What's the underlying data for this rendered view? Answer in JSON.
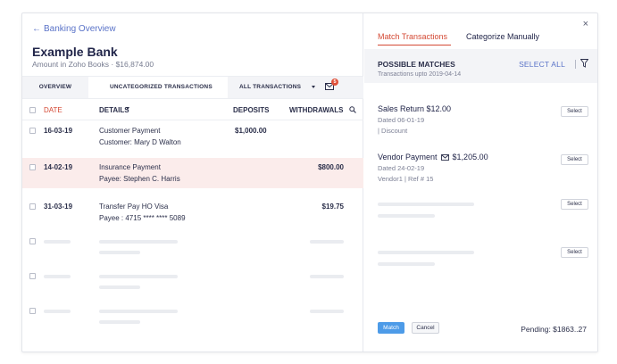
{
  "left": {
    "back_link": "Banking Overview",
    "bank_name": "Example Bank",
    "amount_label": "Amount in Zoho Books",
    "amount_value": "$16,874.00",
    "tabs": {
      "overview": "OVERVIEW",
      "uncategorized": "UNCATEGORIZED TRANSACTIONS",
      "all": "ALL TRANSACTIONS"
    },
    "mail_badge": "5",
    "columns": {
      "date": "DATE",
      "details": "DETAILS",
      "deposits": "DEPOSITS",
      "withdrawals": "WITHDRAWALS"
    },
    "rows": [
      {
        "date": "16-03-19",
        "detail1": "Customer Payment",
        "detail2": "Customer: Mary D Walton",
        "deposit": "$1,000.00",
        "withdrawal": ""
      },
      {
        "date": "14-02-19",
        "detail1": "Insurance Payment",
        "detail2": "Payee: Stephen C. Harris",
        "deposit": "",
        "withdrawal": "$800.00"
      },
      {
        "date": "31-03-19",
        "detail1": "Transfer Pay HO Visa",
        "detail2": "Payee : 4715 **** **** 5089",
        "deposit": "",
        "withdrawal": "$19.75"
      }
    ]
  },
  "right": {
    "tabs": {
      "match": "Match Transactions",
      "categorize": "Categorize Manually"
    },
    "close": "×",
    "header": {
      "title": "POSSIBLE MATCHES",
      "subtitle": "Transactions upto 2019-04-14",
      "select_all": "SELECT ALL"
    },
    "matches": [
      {
        "title": "Sales Return $12.00",
        "line1": "Dated 06-01-19",
        "line2": "| Discount",
        "button": "Select"
      },
      {
        "title_prefix": "Vendor Payment",
        "title_amount": "$1,205.00",
        "line1": "Dated 24-02-19",
        "line2": "Vendor1 | Ref # 15",
        "button": "Select"
      }
    ],
    "placeholder_buttons": [
      "Select",
      "Select"
    ],
    "footer": {
      "match": "Match",
      "cancel": "Cancel",
      "pending": "Pending: $1863..27"
    }
  },
  "colors": {
    "accent": "#d44a35",
    "link": "#5a73c8",
    "primary_button": "#4d9be8",
    "highlight_row": "#fbeceb"
  }
}
